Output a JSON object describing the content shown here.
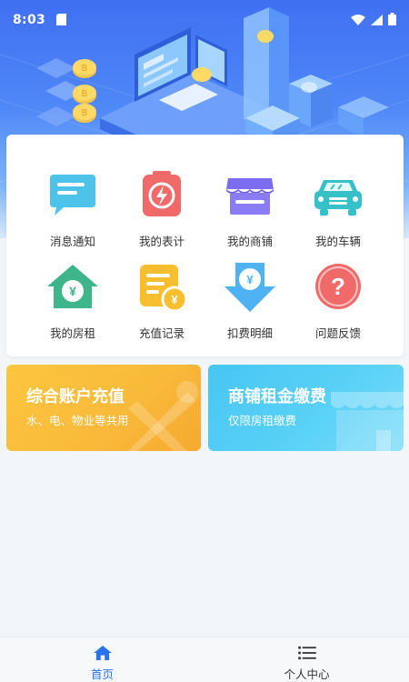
{
  "status_bar": {
    "time": "8:03",
    "icons": [
      "sim-icon",
      "wifi-icon",
      "signal-icon",
      "battery-icon"
    ]
  },
  "grid": {
    "items": [
      {
        "label": "消息通知",
        "icon": "message-icon",
        "color": "#4dc3ea"
      },
      {
        "label": "我的表计",
        "icon": "meter-icon",
        "color": "#f06a6a"
      },
      {
        "label": "我的商铺",
        "icon": "shop-icon",
        "color": "#7b6cf0"
      },
      {
        "label": "我的车辆",
        "icon": "car-icon",
        "color": "#36c0c8"
      },
      {
        "label": "我的房租",
        "icon": "house-icon",
        "color": "#3fb58c"
      },
      {
        "label": "充值记录",
        "icon": "recharge-record-icon",
        "color": "#f7be2e"
      },
      {
        "label": "扣费明细",
        "icon": "deduction-detail-icon",
        "color": "#4fb3f3"
      },
      {
        "label": "问题反馈",
        "icon": "feedback-icon",
        "color": "#f06a6a"
      }
    ]
  },
  "promos": {
    "left": {
      "title": "综合账户充值",
      "subtitle": "水、电、物业等共用",
      "color": "#f9b93a"
    },
    "right": {
      "title": "商铺租金缴费",
      "subtitle": "仅限房租缴费",
      "color": "#52ccf5"
    }
  },
  "bottom_nav": {
    "home_label": "首页",
    "profile_label": "个人中心",
    "active_color": "#2a73ee"
  }
}
